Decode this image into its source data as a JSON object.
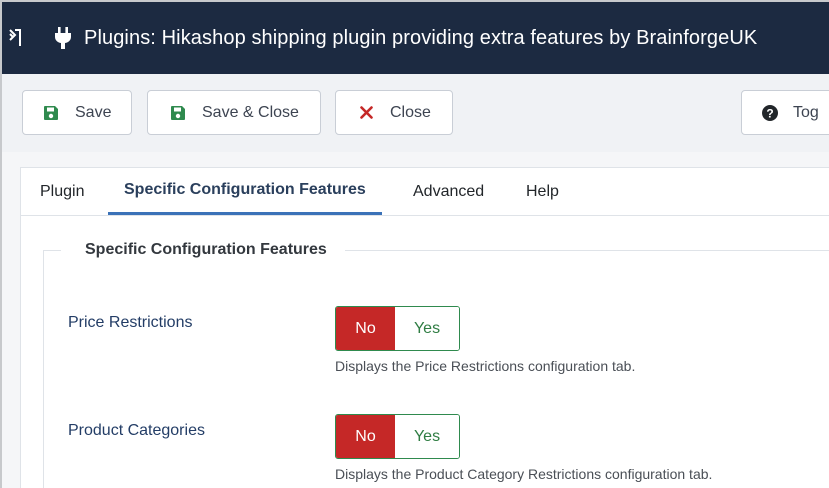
{
  "header": {
    "title": "Plugins: Hikashop shipping plugin providing extra features by BrainforgeUK",
    "toggle_icon": "menu-toggle-icon",
    "plug_icon": "plug-icon",
    "background": "#1c2a41"
  },
  "toolbar": {
    "save_label": "Save",
    "save_close_label": "Save & Close",
    "close_label": "Close",
    "toggle_label": "Tog",
    "accent_close": "#c52827"
  },
  "tabs": [
    {
      "label": "Plugin"
    },
    {
      "label": "Specific Configuration Features",
      "active": true
    },
    {
      "label": "Advanced"
    },
    {
      "label": "Help"
    }
  ],
  "fieldset": {
    "legend": "Specific Configuration Features",
    "fields": [
      {
        "label": "Price Restrictions",
        "options": [
          "No",
          "Yes"
        ],
        "selected": "No",
        "description": "Displays the Price Restrictions configuration tab."
      },
      {
        "label": "Product Categories",
        "options": [
          "No",
          "Yes"
        ],
        "selected": "No",
        "description": "Displays the Product Category Restrictions configuration tab."
      }
    ]
  },
  "colors": {
    "switch_no": "#c52827",
    "switch_yes_text": "#2f7d43",
    "active_tab_underline": "#3b72b8"
  }
}
